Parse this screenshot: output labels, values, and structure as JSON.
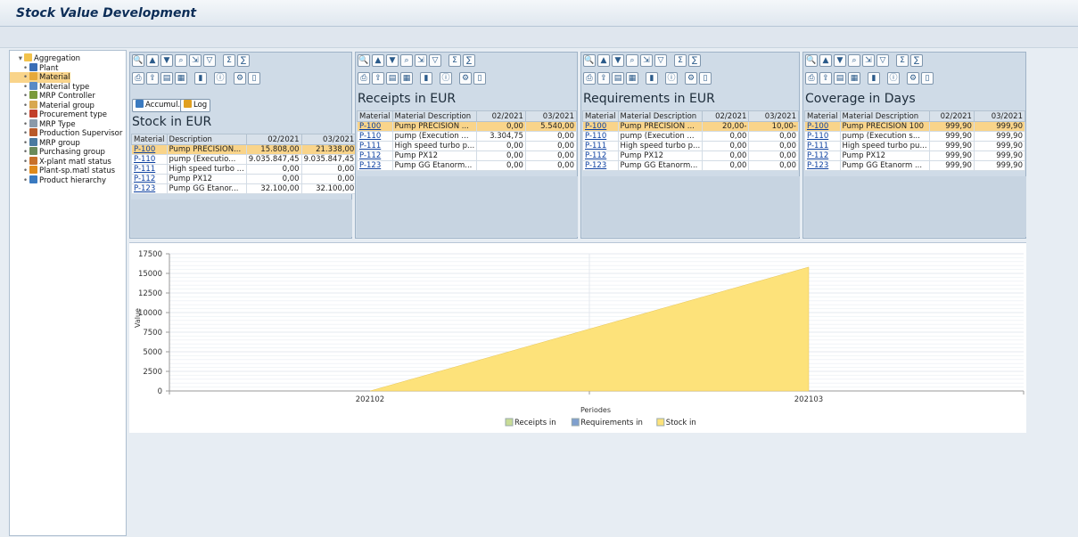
{
  "window": {
    "title": "Stock Value Development"
  },
  "tree": {
    "items": [
      {
        "label": "Aggregation",
        "icon": "folder-open-icon",
        "color": "#f2c24b",
        "level": 0
      },
      {
        "label": "Plant",
        "icon": "plant-icon",
        "color": "#3b6fb6",
        "level": 1
      },
      {
        "label": "Material",
        "icon": "material-icon",
        "color": "#e6a93a",
        "level": 1,
        "selected": true
      },
      {
        "label": "Material type",
        "icon": "material-type-icon",
        "color": "#5a8ac6",
        "level": 1
      },
      {
        "label": "MRP Controller",
        "icon": "mrp-controller-icon",
        "color": "#7a9a3a",
        "level": 1
      },
      {
        "label": "Material group",
        "icon": "material-group-icon",
        "color": "#d8a850",
        "level": 1
      },
      {
        "label": "Procurement type",
        "icon": "procurement-type-icon",
        "color": "#c2402a",
        "level": 1
      },
      {
        "label": "MRP Type",
        "icon": "mrp-type-icon",
        "color": "#8a9aaa",
        "level": 1
      },
      {
        "label": "Production Supervisor",
        "icon": "production-supervisor-icon",
        "color": "#b85a2a",
        "level": 1
      },
      {
        "label": "MRP group",
        "icon": "mrp-group-icon",
        "color": "#4a7aa0",
        "level": 1
      },
      {
        "label": "Purchasing group",
        "icon": "purchasing-group-icon",
        "color": "#6a8a5a",
        "level": 1
      },
      {
        "label": "X-plant matl status",
        "icon": "x-plant-status-icon",
        "color": "#c8702a",
        "level": 1
      },
      {
        "label": "Plant-sp.matl status",
        "icon": "plant-status-icon",
        "color": "#e08a1a",
        "level": 1
      },
      {
        "label": "Product hierarchy",
        "icon": "product-hierarchy-icon",
        "color": "#3a7ac0",
        "level": 1
      }
    ]
  },
  "panels": [
    {
      "title": "Stock in EUR",
      "buttons": [
        {
          "label": "Accumul.",
          "icon": "accumulate-icon"
        },
        {
          "label": "Log",
          "icon": "log-icon"
        }
      ],
      "columns": [
        "Material",
        "Description",
        "02/2021",
        "03/2021"
      ],
      "rows": [
        [
          "P-100",
          "Pump PRECISION...",
          "15.808,00",
          "21.338,00"
        ],
        [
          "P-110",
          "pump   (Executio...",
          "9.035.847,45",
          "9.035.847,45"
        ],
        [
          "P-111",
          "High speed turbo ...",
          "0,00",
          "0,00"
        ],
        [
          "P-112",
          "Pump PX12",
          "0,00",
          "0,00"
        ],
        [
          "P-123",
          "Pump GG  Etanor...",
          "32.100,00",
          "32.100,00"
        ]
      ]
    },
    {
      "title": "Receipts in EUR",
      "columns": [
        "Material",
        "Material Description",
        "02/2021",
        "03/2021"
      ],
      "rows": [
        [
          "P-100",
          "Pump PRECISION ...",
          "0,00",
          "5.540,00"
        ],
        [
          "P-110",
          "pump   (Execution ...",
          "3.304,75",
          "0,00"
        ],
        [
          "P-111",
          "High speed turbo p...",
          "0,00",
          "0,00"
        ],
        [
          "P-112",
          "Pump PX12",
          "0,00",
          "0,00"
        ],
        [
          "P-123",
          "Pump GG  Etanorm...",
          "0,00",
          "0,00"
        ]
      ]
    },
    {
      "title": "Requirements in EUR",
      "columns": [
        "Material",
        "Material Description",
        "02/2021",
        "03/2021"
      ],
      "rows": [
        [
          "P-100",
          "Pump PRECISION ...",
          "20,00-",
          "10,00-"
        ],
        [
          "P-110",
          "pump   (Execution ...",
          "0,00",
          "0,00"
        ],
        [
          "P-111",
          "High speed turbo p...",
          "0,00",
          "0,00"
        ],
        [
          "P-112",
          "Pump PX12",
          "0,00",
          "0,00"
        ],
        [
          "P-123",
          "Pump GG  Etanorm...",
          "0,00",
          "0,00"
        ]
      ]
    },
    {
      "title": "Coverage in Days",
      "columns": [
        "Material",
        "Material Description",
        "02/2021",
        "03/2021"
      ],
      "rows": [
        [
          "P-100",
          "Pump PRECISION 100",
          "999,90",
          "999,90"
        ],
        [
          "P-110",
          "pump   (Execution s...",
          "999,90",
          "999,90"
        ],
        [
          "P-111",
          "High speed turbo pu...",
          "999,90",
          "999,90"
        ],
        [
          "P-112",
          "Pump PX12",
          "999,90",
          "999,90"
        ],
        [
          "P-123",
          "Pump GG  Etanorm ...",
          "999,90",
          "999,90"
        ]
      ]
    }
  ],
  "toolbar_icons": [
    "zoom-icon",
    "sort-ascending-icon",
    "sort-descending-icon",
    "find-icon",
    "find-next-icon",
    "filter-icon",
    "sum-icon",
    "subtotal-icon",
    "print-icon",
    "export-icon",
    "views-icon",
    "layout-icon",
    "graphic-icon",
    "info-icon",
    "settings-icon",
    "more-icon"
  ],
  "chart_data": {
    "type": "area",
    "categories": [
      "202102",
      "202103"
    ],
    "series": [
      {
        "name": "Receipts in",
        "values": [
          0,
          0
        ],
        "color": "#c8dc96"
      },
      {
        "name": "Requirements in",
        "values": [
          0,
          0
        ],
        "color": "#7f9fce"
      },
      {
        "name": "Stock in",
        "values": [
          0,
          15808
        ],
        "color": "#fde27a"
      }
    ],
    "xlabel": "Periodes",
    "ylabel": "Value",
    "yticks": [
      0,
      2500,
      5000,
      7500,
      10000,
      12500,
      15000,
      17500
    ],
    "ylim": [
      0,
      17500
    ],
    "legend_position": "bottom",
    "grid": true
  }
}
